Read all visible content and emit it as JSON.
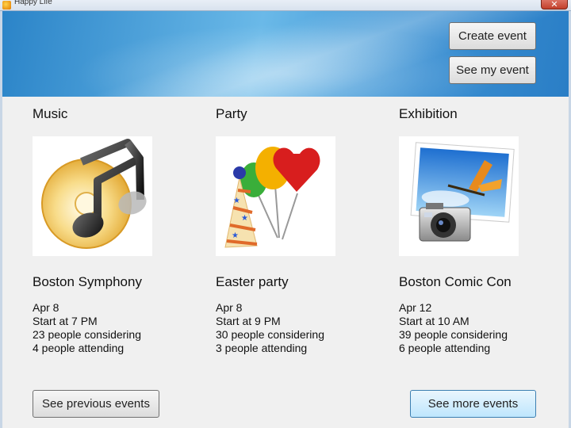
{
  "window": {
    "title": "Happy Life",
    "close_glyph": "✕"
  },
  "header": {
    "create_event_label": "Create event",
    "see_my_event_label": "See my event"
  },
  "events": [
    {
      "category": "Music",
      "icon": "music-note-disc-icon",
      "title": "Boston Symphony",
      "date": "Apr  8",
      "start": "Start at 7 PM",
      "considering": "23 people considering",
      "attending": "4 people attending"
    },
    {
      "category": "Party",
      "icon": "party-balloons-icon",
      "title": "Easter party",
      "date": "Apr  8",
      "start": "Start at 9 PM",
      "considering": "30 people considering",
      "attending": "3 people attending"
    },
    {
      "category": "Exhibition",
      "icon": "camera-photo-icon",
      "title": "Boston Comic Con",
      "date": "Apr  12",
      "start": "Start at 10 AM",
      "considering": "39 people considering",
      "attending": "6 people attending"
    }
  ],
  "footer": {
    "previous_label": "See previous events",
    "more_label": "See more events"
  },
  "colors": {
    "banner": "#3a8fd2",
    "background": "#f0f0f0",
    "primary_button": "#bee6fd"
  }
}
